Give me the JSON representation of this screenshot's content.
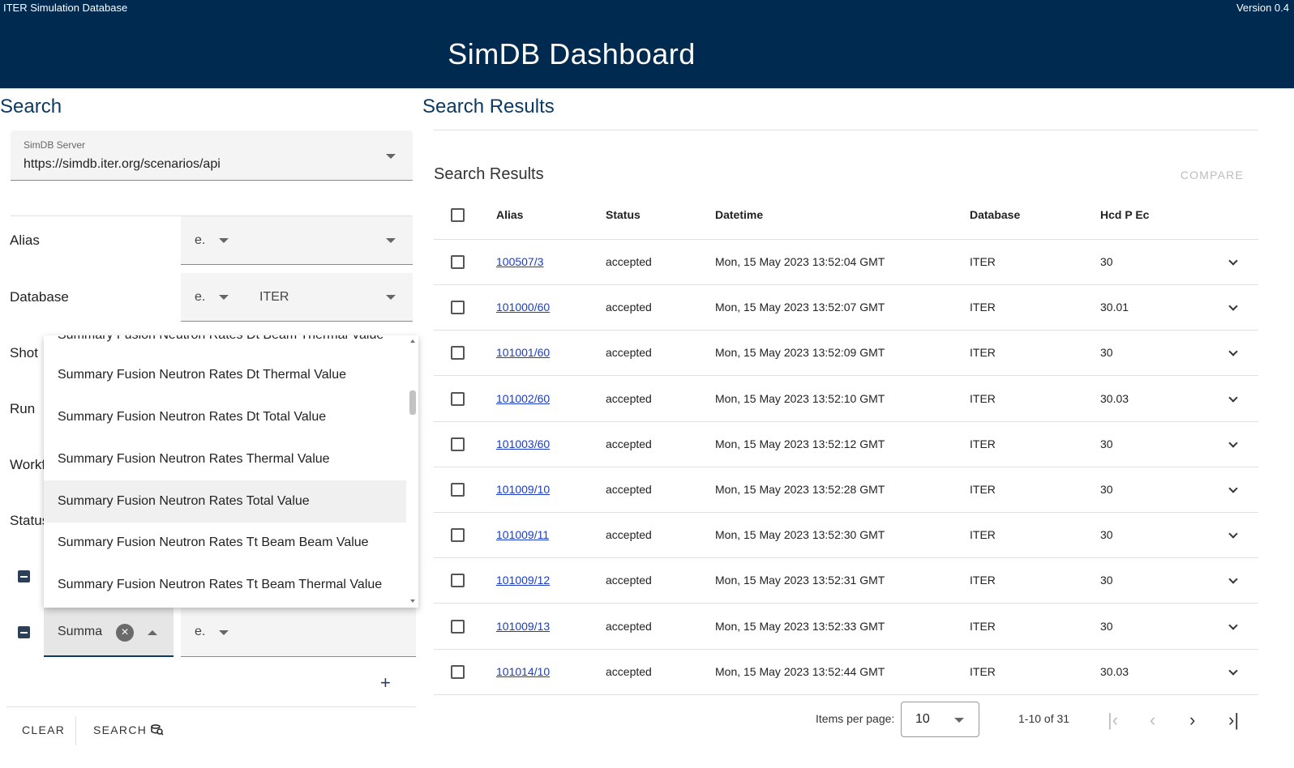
{
  "header": {
    "org": "ITER Simulation Database",
    "version": "Version 0.4",
    "title": "SimDB Dashboard"
  },
  "search": {
    "title": "Search",
    "server": {
      "label": "SimDB Server",
      "value": "https://simdb.iter.org/scenarios/api"
    },
    "rows": {
      "alias": {
        "label": "Alias",
        "op": "e.",
        "value": ""
      },
      "database": {
        "label": "Database",
        "op": "e.",
        "value": "ITER"
      },
      "shot": {
        "label": "Shot"
      },
      "run": {
        "label": "Run"
      },
      "workflow": {
        "label": "Workf"
      },
      "status": {
        "label": "Status"
      }
    },
    "custom_field": {
      "value": "Summa",
      "op": "e."
    },
    "dropdown_options": [
      "Summary Fusion Neutron Rates Dt Beam Thermal Value",
      "Summary Fusion Neutron Rates Dt Thermal Value",
      "Summary Fusion Neutron Rates Dt Total Value",
      "Summary Fusion Neutron Rates Thermal Value",
      "Summary Fusion Neutron Rates Total Value",
      "Summary Fusion Neutron Rates Tt Beam Beam Value",
      "Summary Fusion Neutron Rates Tt Beam Thermal Value"
    ],
    "add_label": "+",
    "clear_label": "CLEAR",
    "search_label": "SEARCH"
  },
  "results": {
    "pane_title": "Search Results",
    "card_title": "Search Results",
    "compare_label": "COMPARE",
    "columns": [
      "Alias",
      "Status",
      "Datetime",
      "Database",
      "Hcd P Ec"
    ],
    "rows": [
      {
        "alias": "100507/3",
        "status": "accepted",
        "datetime": "Mon, 15 May 2023 13:52:04 GMT",
        "database": "ITER",
        "hcd": "30"
      },
      {
        "alias": "101000/60",
        "status": "accepted",
        "datetime": "Mon, 15 May 2023 13:52:07 GMT",
        "database": "ITER",
        "hcd": "30.01"
      },
      {
        "alias": "101001/60",
        "status": "accepted",
        "datetime": "Mon, 15 May 2023 13:52:09 GMT",
        "database": "ITER",
        "hcd": "30"
      },
      {
        "alias": "101002/60",
        "status": "accepted",
        "datetime": "Mon, 15 May 2023 13:52:10 GMT",
        "database": "ITER",
        "hcd": "30.03"
      },
      {
        "alias": "101003/60",
        "status": "accepted",
        "datetime": "Mon, 15 May 2023 13:52:12 GMT",
        "database": "ITER",
        "hcd": "30"
      },
      {
        "alias": "101009/10",
        "status": "accepted",
        "datetime": "Mon, 15 May 2023 13:52:28 GMT",
        "database": "ITER",
        "hcd": "30"
      },
      {
        "alias": "101009/11",
        "status": "accepted",
        "datetime": "Mon, 15 May 2023 13:52:30 GMT",
        "database": "ITER",
        "hcd": "30"
      },
      {
        "alias": "101009/12",
        "status": "accepted",
        "datetime": "Mon, 15 May 2023 13:52:31 GMT",
        "database": "ITER",
        "hcd": "30"
      },
      {
        "alias": "101009/13",
        "status": "accepted",
        "datetime": "Mon, 15 May 2023 13:52:33 GMT",
        "database": "ITER",
        "hcd": "30"
      },
      {
        "alias": "101014/10",
        "status": "accepted",
        "datetime": "Mon, 15 May 2023 13:52:44 GMT",
        "database": "ITER",
        "hcd": "30.03"
      }
    ],
    "pager": {
      "items_per_page_label": "Items per page:",
      "items_per_page": "10",
      "range": "1-10 of 31"
    }
  }
}
